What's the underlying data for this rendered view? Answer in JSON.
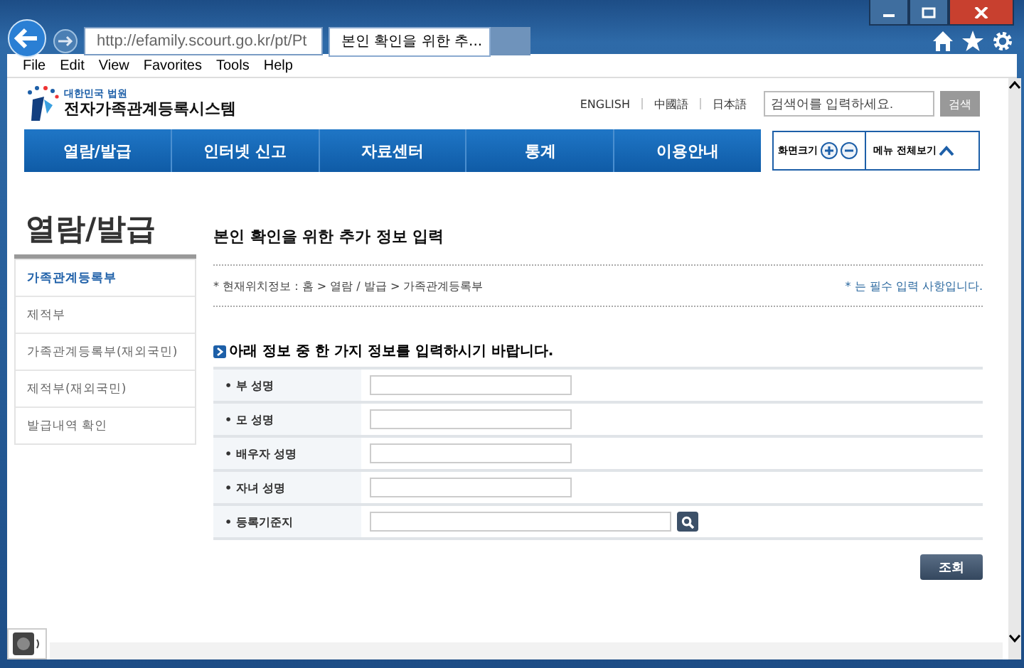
{
  "browser": {
    "address": "http://efamily.scourt.go.kr/pt/Pt",
    "tab_title": "본인 확인을 위한 추...",
    "menu": [
      "File",
      "Edit",
      "View",
      "Favorites",
      "Tools",
      "Help"
    ]
  },
  "header": {
    "logo_small": "대한민국 법원",
    "logo_title": "전자가족관계등록시스템",
    "languages": [
      "ENGLISH",
      "中國語",
      "日本語"
    ],
    "search": {
      "placeholder": "검색어를 입력하세요."
    },
    "search_button": "검색"
  },
  "nav": [
    "열람/발급",
    "인터넷 신고",
    "자료센터",
    "통계",
    "이용안내"
  ],
  "tools": {
    "zoom_label": "화면크기",
    "menu_all": "메뉴 전체보기"
  },
  "sidebar": {
    "title": "열람/발급",
    "items": [
      {
        "label": "가족관계등록부",
        "selected": true
      },
      {
        "label": "제적부",
        "selected": false
      },
      {
        "label": "가족관계등록부(재외국민)",
        "selected": false
      },
      {
        "label": "제적부(재외국민)",
        "selected": false
      },
      {
        "label": "발급내역 확인",
        "selected": false
      }
    ]
  },
  "content": {
    "title": "본인 확인을 위한 추가 정보 입력",
    "breadcrumb": "* 현재위치정보 : 홈 > 열람 / 발급 > 가족관계등록부",
    "required_note": "* 는 필수 입력 사항입니다.",
    "form_heading": "아래 정보 중 한 가지 정보를 입력하시기 바랍니다.",
    "fields": [
      {
        "label": "• 부 성명",
        "kind": "text"
      },
      {
        "label": "• 모 성명",
        "kind": "text"
      },
      {
        "label": "• 배우자 성명",
        "kind": "text"
      },
      {
        "label": "• 자녀 성명",
        "kind": "text"
      },
      {
        "label": "• 등록기준지",
        "kind": "search"
      }
    ],
    "submit": "조회"
  }
}
